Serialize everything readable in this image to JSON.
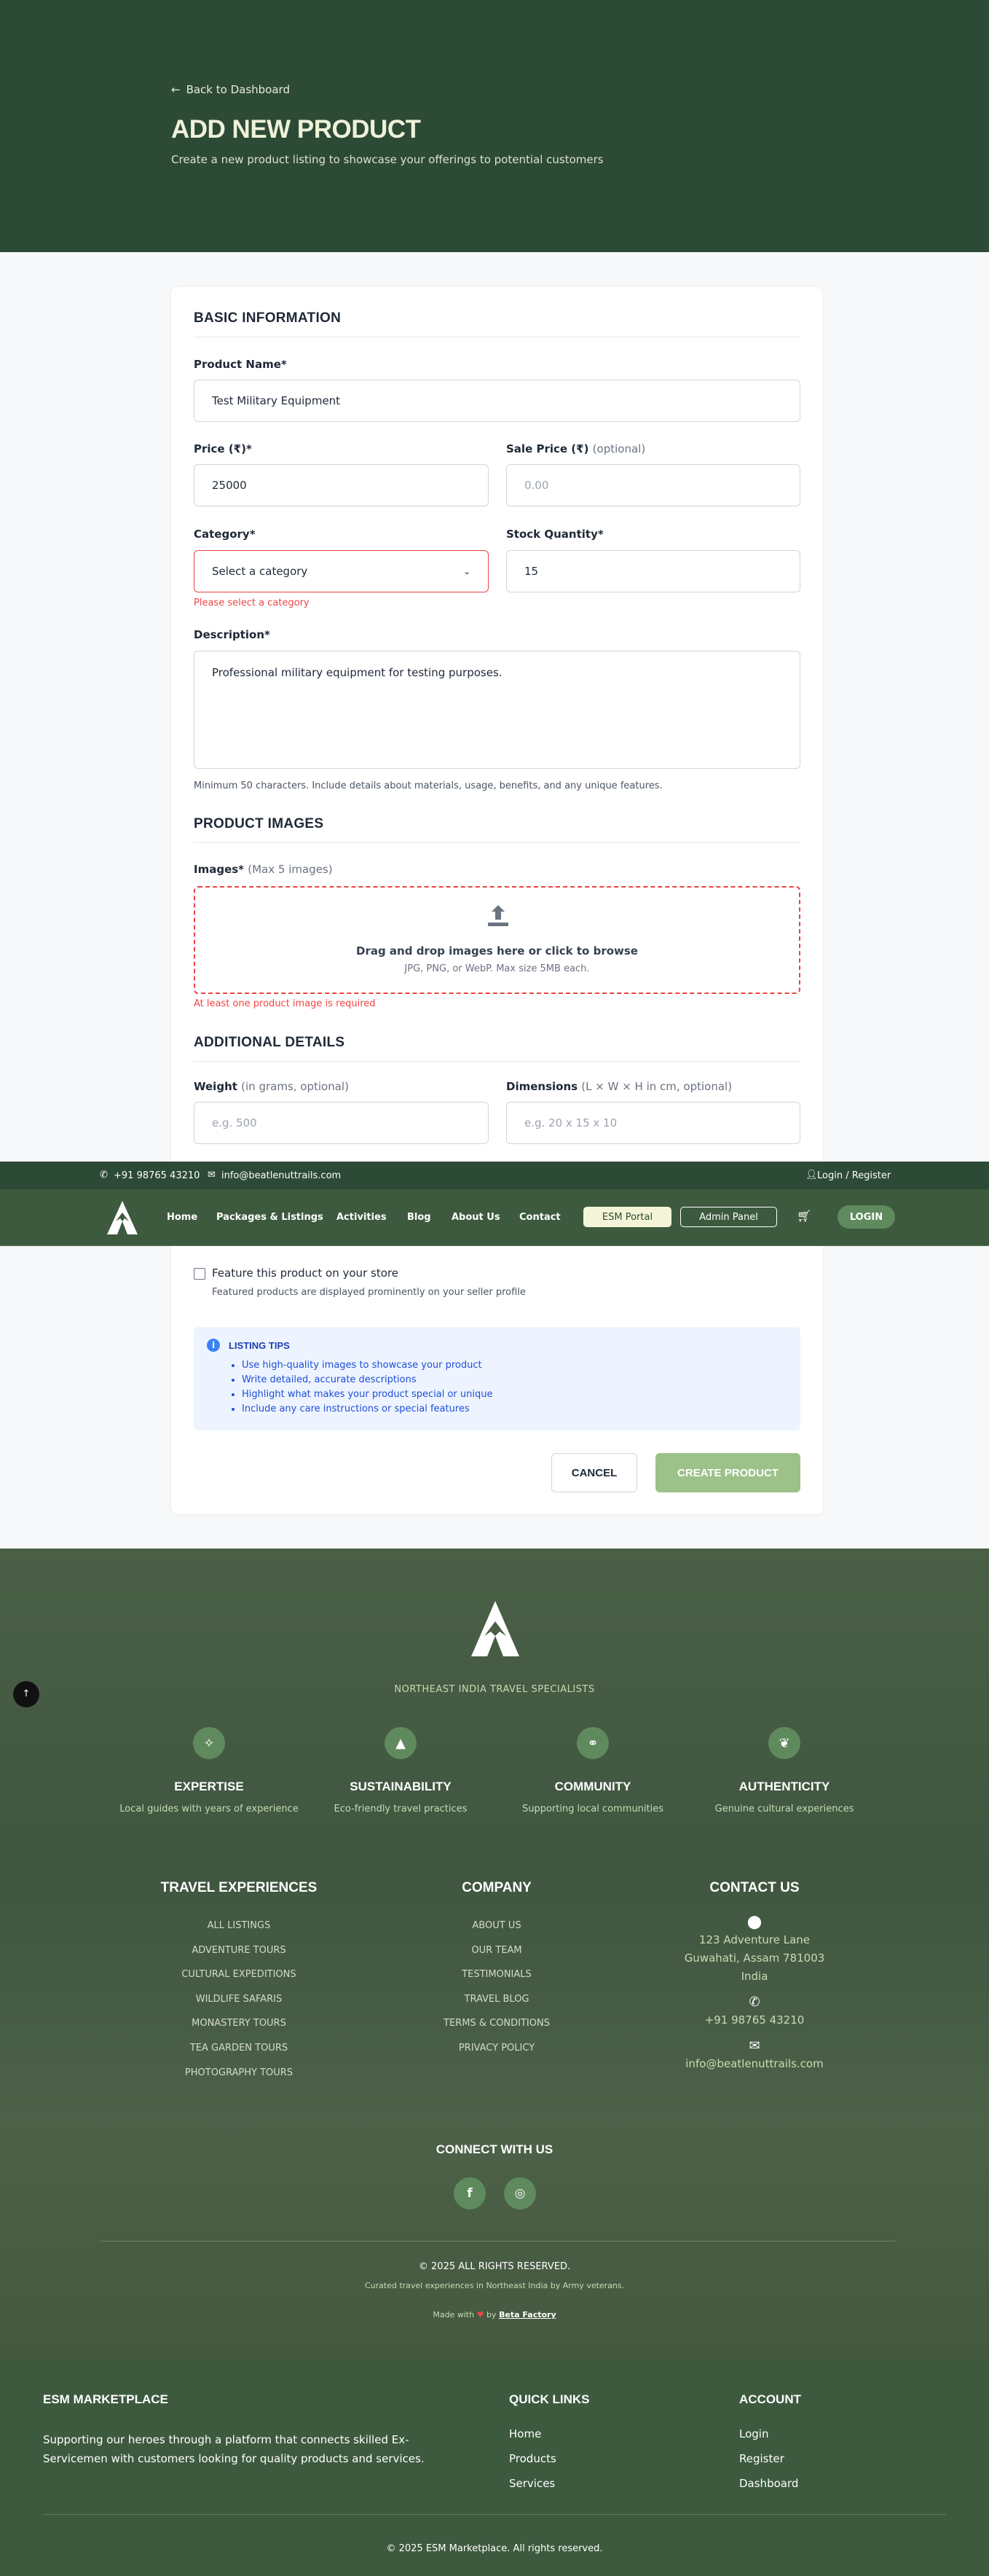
{
  "header": {
    "back": "Back to Dashboard",
    "title": "ADD NEW PRODUCT",
    "subtitle": "Create a new product listing to showcase your offerings to potential customers"
  },
  "form": {
    "basic_title": "BASIC INFORMATION",
    "product_name_label": "Product Name*",
    "product_name_value": "Test Military Equipment",
    "price_label": "Price (₹)*",
    "price_value": "25000",
    "sale_price_label": "Sale Price (₹)",
    "sale_price_opt": "(optional)",
    "sale_price_placeholder": "0.00",
    "category_label": "Category*",
    "category_value": "Select a category",
    "category_error": "Please select a category",
    "stock_label": "Stock Quantity*",
    "stock_value": "15",
    "description_label": "Description*",
    "description_value": "Professional military equipment for testing purposes.",
    "description_hint": "Minimum 50 characters. Include details about materials, usage, benefits, and any unique features.",
    "images_title": "PRODUCT IMAGES",
    "images_label": "Images*",
    "images_opt": "(Max 5 images)",
    "drop_main": "Drag and drop images here or click to browse",
    "drop_sub": "JPG, PNG, or WebP. Max size 5MB each.",
    "images_error": "At least one product image is required",
    "additional_title": "ADDITIONAL DETAILS",
    "weight_label": "Weight",
    "weight_opt": "(in grams, optional)",
    "weight_placeholder": "e.g. 500",
    "dimensions_label": "Dimensions",
    "dimensions_opt": "(L × W × H in cm, optional)",
    "dimensions_placeholder": "e.g. 20 x 15 x 10",
    "feature_label": "Feature this product on your store",
    "feature_hint": "Featured products are displayed prominently on your seller profile",
    "tips_title": "LISTING TIPS",
    "tips": [
      "Use high-quality images to showcase your product",
      "Write detailed, accurate descriptions",
      "Highlight what makes your product special or unique",
      "Include any care instructions or special features"
    ],
    "cancel": "CANCEL",
    "create": "CREATE PRODUCT"
  },
  "topbar": {
    "phone": "+91 98765 43210",
    "email": "info@beatlenuttrails.com",
    "login": "Login / Register"
  },
  "nav": {
    "items": [
      "Home",
      "Packages & Listings",
      "Activities",
      "Blog",
      "About Us",
      "Contact"
    ],
    "esm_portal": "ESM Portal",
    "admin_panel": "Admin Panel",
    "login": "LOGIN"
  },
  "footer": {
    "tagline": "NORTHEAST INDIA TRAVEL SPECIALISTS",
    "pillars": [
      {
        "title": "EXPERTISE",
        "desc": "Local guides with years of experience",
        "icon": "compass-icon"
      },
      {
        "title": "SUSTAINABILITY",
        "desc": "Eco-friendly travel practices",
        "icon": "bell-icon"
      },
      {
        "title": "COMMUNITY",
        "desc": "Supporting local communities",
        "icon": "handshake-icon"
      },
      {
        "title": "AUTHENTICITY",
        "desc": "Genuine cultural experiences",
        "icon": "leaf-icon"
      }
    ],
    "travel_title": "TRAVEL EXPERIENCES",
    "travel": [
      "ALL LISTINGS",
      "ADVENTURE TOURS",
      "CULTURAL EXPEDITIONS",
      "WILDLIFE SAFARIS",
      "MONASTERY TOURS",
      "TEA GARDEN TOURS",
      "PHOTOGRAPHY TOURS"
    ],
    "company_title": "COMPANY",
    "company": [
      "ABOUT US",
      "OUR TEAM",
      "TESTIMONIALS",
      "TRAVEL BLOG",
      "TERMS & CONDITIONS",
      "PRIVACY POLICY"
    ],
    "contact_title": "CONTACT US",
    "address1": "123 Adventure Lane",
    "address2": "Guwahati, Assam 781003",
    "address3": "India",
    "phone": "+91 98765 43210",
    "email": "info@beatlenuttrails.com",
    "connect": "CONNECT WITH US",
    "copyright": "© 2025 ALL RIGHTS RESERVED.",
    "curated": "Curated travel experiences in Northeast India by Army veterans.",
    "made_with": "Made with",
    "by": "by",
    "maker": "Beta Factory"
  },
  "bottom": {
    "title": "ESM MARKETPLACE",
    "desc": "Supporting our heroes through a platform that connects skilled Ex-Servicemen with customers looking for quality products and services.",
    "quick_title": "QUICK LINKS",
    "quick": [
      "Home",
      "Products",
      "Services"
    ],
    "account_title": "ACCOUNT",
    "account": [
      "Login",
      "Register",
      "Dashboard"
    ],
    "copyright": "© 2025 ESM Marketplace. All rights reserved."
  }
}
